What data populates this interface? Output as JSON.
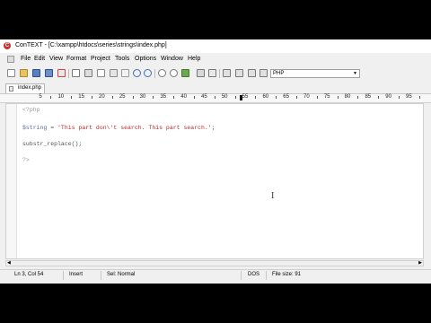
{
  "window": {
    "title": "ConTEXT - [C:\\xampp\\htdocs\\series\\strings\\index.php]"
  },
  "menu": {
    "items": [
      "File",
      "Edit",
      "View",
      "Format",
      "Project",
      "Tools",
      "Options",
      "Window",
      "Help"
    ]
  },
  "toolbar": {
    "language": "PHP"
  },
  "tabs": [
    {
      "label": "index.php"
    }
  ],
  "ruler": {
    "numbers": [
      "5",
      "10",
      "15",
      "20",
      "25",
      "30",
      "35",
      "40",
      "45",
      "50",
      "55",
      "60",
      "65",
      "70",
      "75",
      "80",
      "85",
      "90",
      "95"
    ]
  },
  "editor": {
    "line1": "<?php",
    "line3_var": "$string",
    "line3_op": " = ",
    "line3_str": "'This part don\\'t search. This part search.'",
    "line3_end": ";",
    "line5": "substr_replace();",
    "line7": "?>"
  },
  "status": {
    "position": "Ln 3, Col 54",
    "mode": "Insert",
    "selection": "Sel: Normal",
    "format": "DOS",
    "filesize": "File size: 91"
  },
  "colors": {
    "variable": "#5e6c9a",
    "string": "#b22a2a",
    "delimiter": "#9a9a9a"
  }
}
